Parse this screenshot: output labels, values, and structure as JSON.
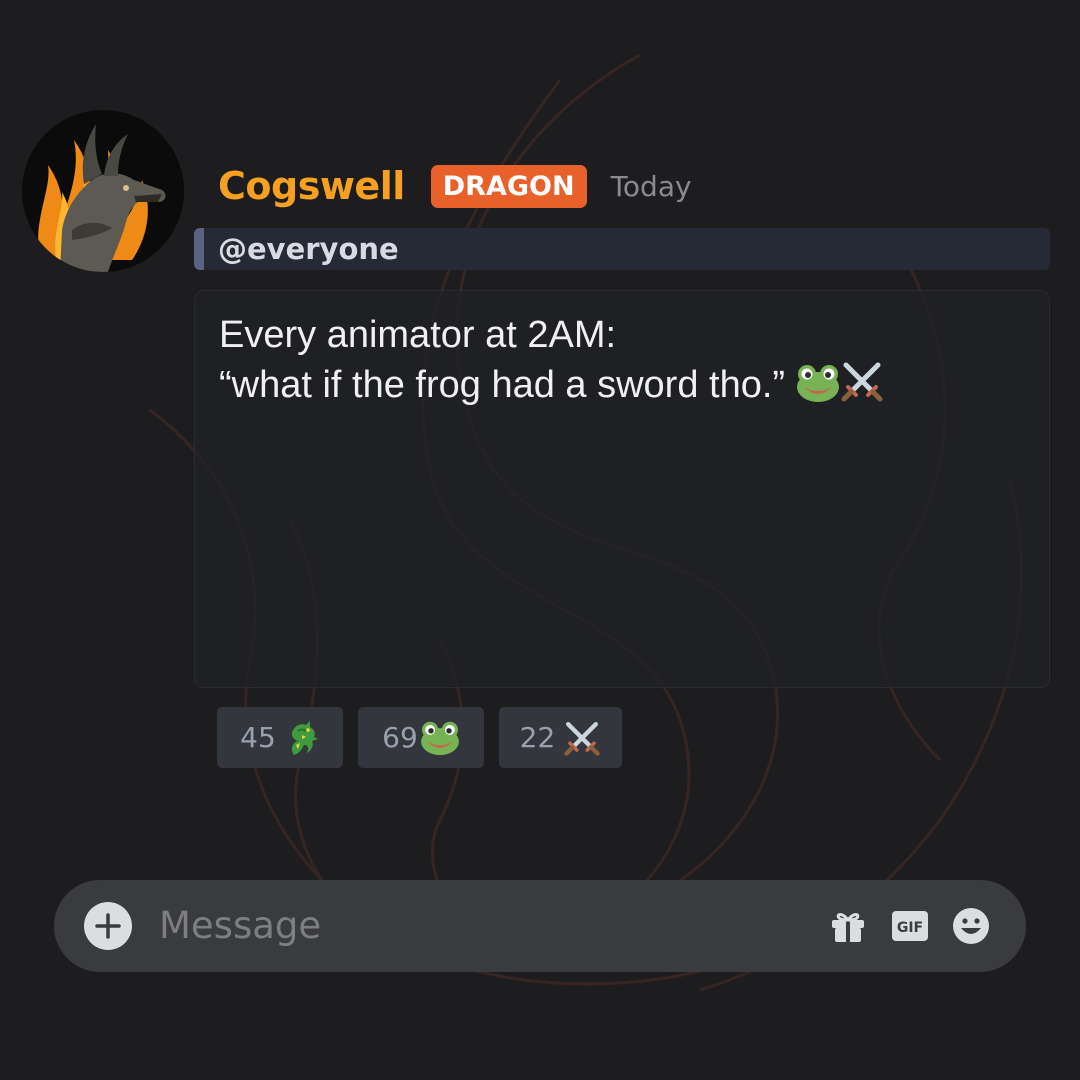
{
  "message": {
    "author": "Cogswell",
    "role_badge": "DRAGON",
    "timestamp": "Today",
    "mention": "@everyone",
    "lines": [
      "Every animator at 2AM:",
      "“what if the frog had a sword tho.”"
    ],
    "inline_emoji_icons": [
      "frog-icon",
      "crossed-swords-icon"
    ]
  },
  "reactions": [
    {
      "count": "45",
      "icon": "dragon-icon"
    },
    {
      "count": "69",
      "icon": "frog-icon"
    },
    {
      "count": "22",
      "icon": "crossed-swords-icon"
    }
  ],
  "composer": {
    "placeholder": "Message",
    "gif_label": "GIF",
    "icons": [
      "add-icon",
      "gift-icon",
      "gif-icon",
      "emoji-icon"
    ]
  },
  "colors": {
    "background": "#1d1d1f",
    "author_name": "#f5a021",
    "role_badge": "#e8612a",
    "mention_accent": "#5a6382",
    "reaction_background": "#33363c",
    "composer_background": "#3a3b3e"
  }
}
